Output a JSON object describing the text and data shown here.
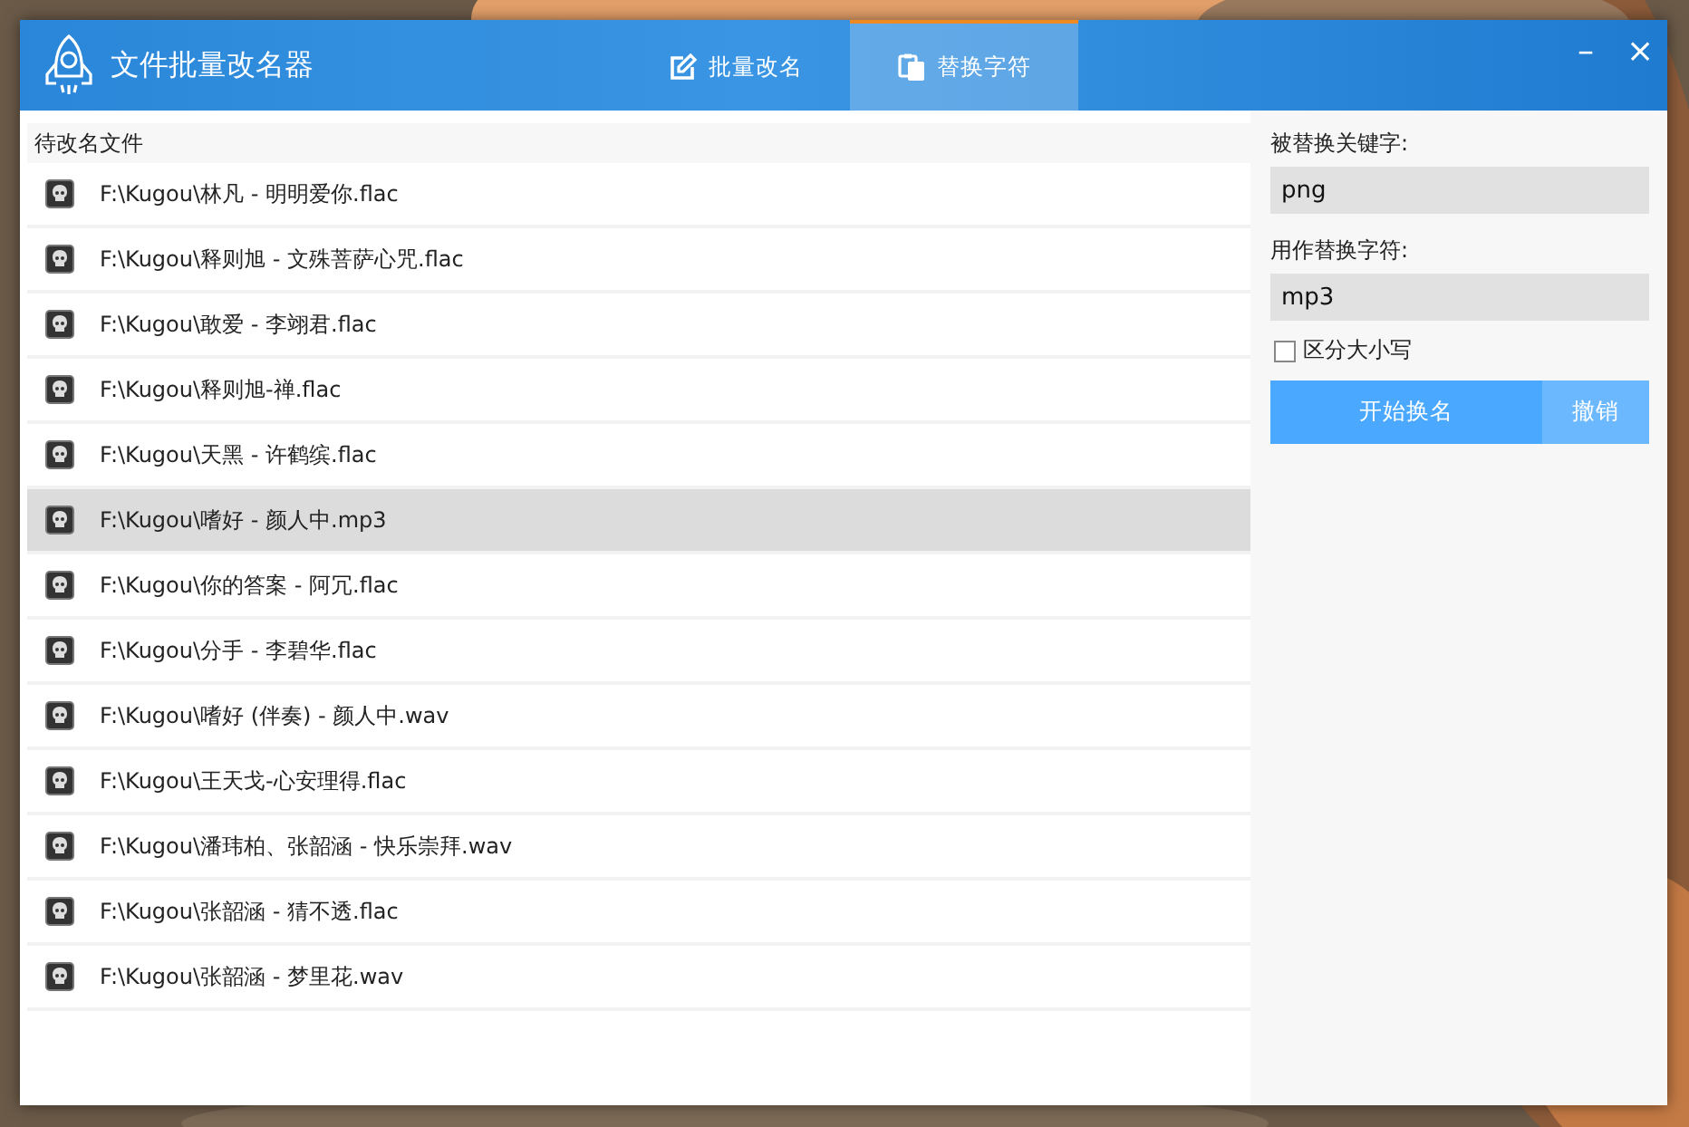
{
  "window": {
    "title": "文件批量改名器",
    "minimize": "–",
    "close": "×"
  },
  "tabs": [
    {
      "label": "批量改名",
      "selected": false
    },
    {
      "label": "替换字符",
      "selected": true
    }
  ],
  "file_list": {
    "header": "待改名文件",
    "rows": [
      {
        "path": "F:\\Kugou\\林凡 - 明明爱你.flac",
        "selected": false
      },
      {
        "path": "F:\\Kugou\\释则旭 - 文殊菩萨心咒.flac",
        "selected": false
      },
      {
        "path": "F:\\Kugou\\敢爱 - 李翊君.flac",
        "selected": false
      },
      {
        "path": "F:\\Kugou\\释则旭-禅.flac",
        "selected": false
      },
      {
        "path": "F:\\Kugou\\天黑 - 许鹤缤.flac",
        "selected": false
      },
      {
        "path": "F:\\Kugou\\嗜好 - 颜人中.mp3",
        "selected": true
      },
      {
        "path": "F:\\Kugou\\你的答案 - 阿冗.flac",
        "selected": false
      },
      {
        "path": "F:\\Kugou\\分手 - 李碧华.flac",
        "selected": false
      },
      {
        "path": "F:\\Kugou\\嗜好 (伴奏) - 颜人中.wav",
        "selected": false
      },
      {
        "path": "F:\\Kugou\\王天戈-心安理得.flac",
        "selected": false
      },
      {
        "path": "F:\\Kugou\\潘玮柏、张韶涵 - 快乐崇拜.wav",
        "selected": false
      },
      {
        "path": "F:\\Kugou\\张韶涵 - 猜不透.flac",
        "selected": false
      },
      {
        "path": "F:\\Kugou\\张韶涵 - 梦里花.wav",
        "selected": false
      }
    ]
  },
  "replace_panel": {
    "keyword_label": "被替换关键字:",
    "keyword_value": "png",
    "replacement_label": "用作替换字符:",
    "replacement_value": "mp3",
    "case_sensitive": {
      "label": "区分大小写",
      "checked": false
    },
    "buttons": [
      {
        "label": "开始换名",
        "kind": "primary"
      },
      {
        "label": "撤销",
        "kind": "secondary"
      }
    ]
  }
}
